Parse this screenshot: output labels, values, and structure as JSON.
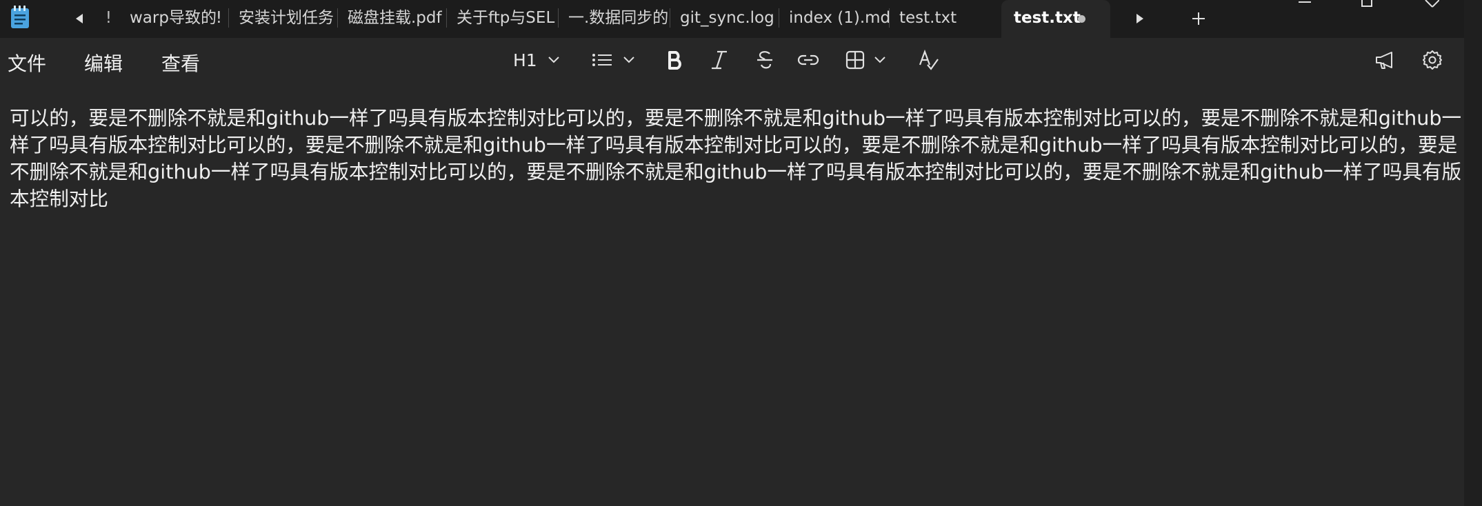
{
  "tabs": [
    {
      "label": "warp导致的ǃ"
    },
    {
      "label": "安装计划任务"
    },
    {
      "label": "磁盘挂载.pdf"
    },
    {
      "label": "关于ftp与SEL"
    },
    {
      "label": "一.数据同步的"
    },
    {
      "label": "git_sync.log"
    },
    {
      "label": "index (1).md"
    },
    {
      "label": "test.txt"
    },
    {
      "label": "test.txt"
    }
  ],
  "menu": {
    "file": "文件",
    "edit": "编辑",
    "view": "查看"
  },
  "toolbar": {
    "heading": "H1"
  },
  "document": {
    "text": "可以的，要是不删除不就是和github一样了吗具有版本控制对比可以的，要是不删除不就是和github一样了吗具有版本控制对比可以的，要是不删除不就是和github一样了吗具有版本控制对比可以的，要是不删除不就是和github一样了吗具有版本控制对比可以的，要是不删除不就是和github一样了吗具有版本控制对比可以的，要是不删除不就是和github一样了吗具有版本控制对比可以的，要是不删除不就是和github一样了吗具有版本控制对比可以的，要是不删除不就是和github一样了吗具有版本控制对比"
  },
  "icons": [
    "notepad-app-icon",
    "scroll-tabs-left-icon",
    "scroll-tabs-right-icon",
    "new-tab-icon",
    "minimize-icon",
    "maximize-icon",
    "close-icon",
    "list-icon",
    "bold-icon",
    "italic-icon",
    "strikethrough-icon",
    "link-icon",
    "table-icon",
    "spellcheck-icon",
    "megaphone-icon",
    "gear-icon",
    "chevron-down-icon"
  ],
  "colors": {
    "titlebar": "#1c1c1c",
    "editor": "#272727",
    "text": "#f0f0f0",
    "app_icon": "#4aa3df"
  }
}
